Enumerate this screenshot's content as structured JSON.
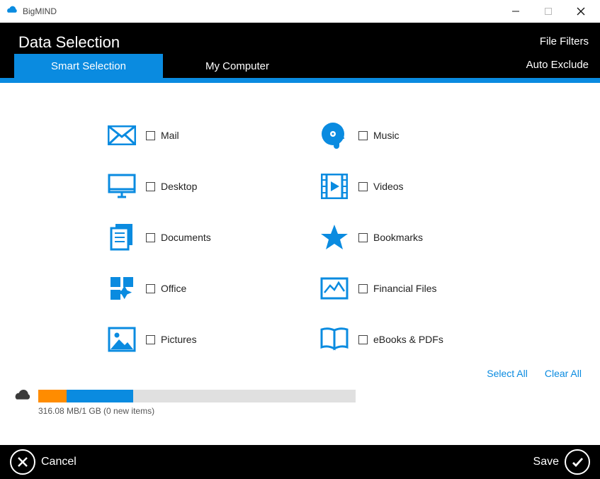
{
  "app": {
    "title": "BigMIND"
  },
  "header": {
    "heading": "Data Selection",
    "rightlinks": {
      "filters": "File Filters",
      "exclude": "Auto Exclude"
    },
    "tabs": {
      "smart": "Smart Selection",
      "mycomputer": "My Computer"
    }
  },
  "categories": {
    "mail": "Mail",
    "music": "Music",
    "desktop": "Desktop",
    "videos": "Videos",
    "documents": "Documents",
    "bookmarks": "Bookmarks",
    "office": "Office",
    "financial": "Financial Files",
    "pictures": "Pictures",
    "ebooks": "eBooks & PDFs"
  },
  "actions": {
    "selectAll": "Select All",
    "clearAll": "Clear All"
  },
  "storage": {
    "orangePct": 9,
    "bluePct": 30,
    "text": "316.08 MB/1 GB (0 new items)"
  },
  "footer": {
    "cancel": "Cancel",
    "save": "Save"
  }
}
